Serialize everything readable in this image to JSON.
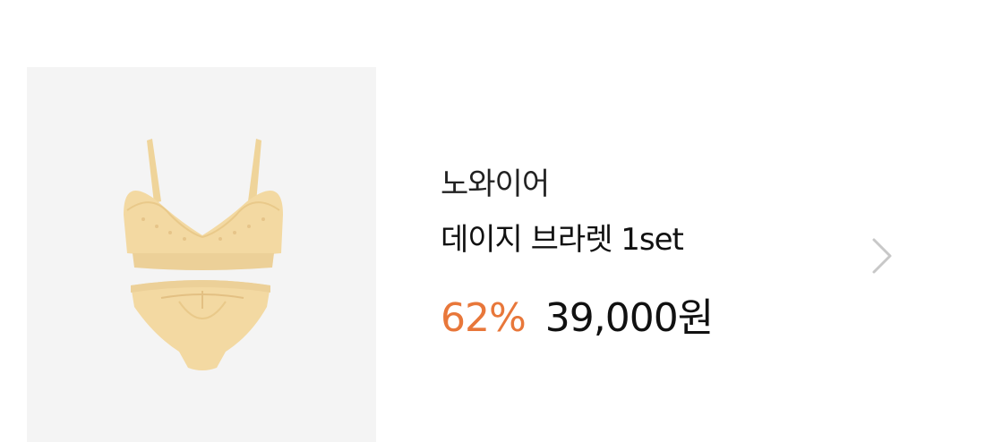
{
  "product": {
    "brand": "노와이어",
    "name": "데이지 브라렛 1set",
    "discount": "62%",
    "price": "39,000원",
    "image": {
      "description_icon": "lingerie-set-image",
      "background_color": "#f4f4f4",
      "garment_color": "#f3d9a2"
    }
  },
  "colors": {
    "discount": "#e8773a",
    "text": "#111111",
    "chevron": "#c8c8c8"
  },
  "icons": {
    "next": "chevron-right-icon"
  }
}
